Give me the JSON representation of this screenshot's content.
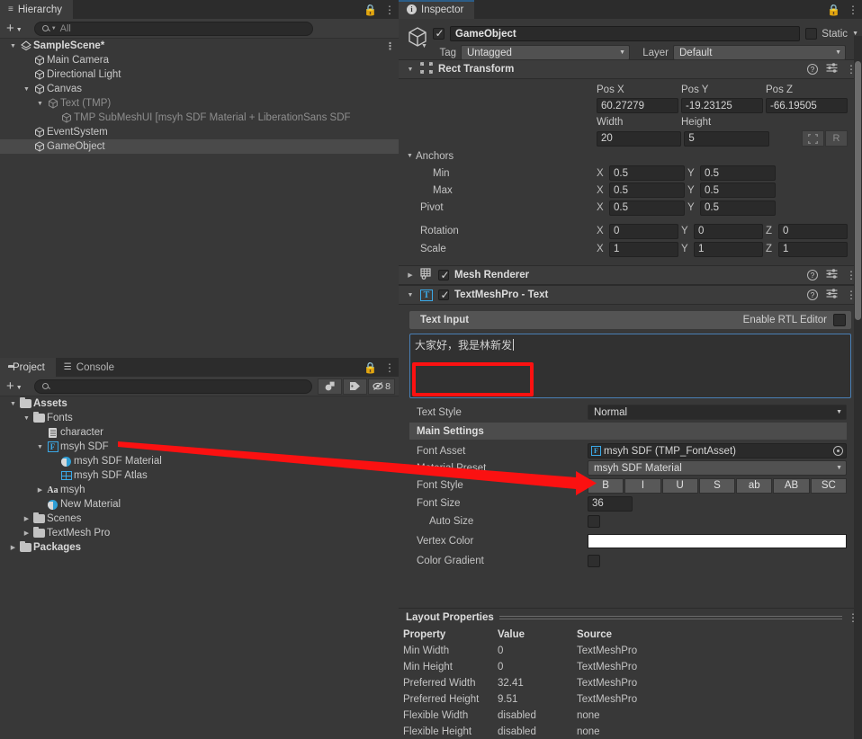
{
  "hierarchy": {
    "tab_label": "Hierarchy",
    "search_placeholder": "All",
    "items": [
      {
        "label": "SampleScene*",
        "depth": 0,
        "icon": "scene-icon",
        "arrow": "open",
        "bold": true,
        "dim": false,
        "selected": false,
        "kebab": true
      },
      {
        "label": "Main Camera",
        "depth": 1,
        "icon": "cube-icon",
        "arrow": "none",
        "bold": false,
        "dim": false,
        "selected": false,
        "kebab": false
      },
      {
        "label": "Directional Light",
        "depth": 1,
        "icon": "cube-icon",
        "arrow": "none",
        "bold": false,
        "dim": false,
        "selected": false,
        "kebab": false
      },
      {
        "label": "Canvas",
        "depth": 1,
        "icon": "cube-icon",
        "arrow": "open",
        "bold": false,
        "dim": false,
        "selected": false,
        "kebab": false
      },
      {
        "label": "Text (TMP)",
        "depth": 2,
        "icon": "cube-icon",
        "arrow": "open",
        "bold": false,
        "dim": true,
        "selected": false,
        "kebab": false
      },
      {
        "label": "TMP SubMeshUI [msyh SDF Material + LiberationSans SDF",
        "depth": 3,
        "icon": "cube-icon",
        "arrow": "none",
        "bold": false,
        "dim": true,
        "selected": false,
        "kebab": false
      },
      {
        "label": "EventSystem",
        "depth": 1,
        "icon": "cube-icon",
        "arrow": "none",
        "bold": false,
        "dim": false,
        "selected": false,
        "kebab": false
      },
      {
        "label": "GameObject",
        "depth": 1,
        "icon": "cube-icon",
        "arrow": "none",
        "bold": false,
        "dim": false,
        "selected": true,
        "kebab": false
      }
    ]
  },
  "project": {
    "tab_label": "Project",
    "console_tab_label": "Console",
    "search_placeholder": "",
    "error_count": "8",
    "items": [
      {
        "label": "Assets",
        "depth": 0,
        "icon": "folder-open-icon",
        "arrow": "open",
        "bold": true,
        "dim": false
      },
      {
        "label": "Fonts",
        "depth": 1,
        "icon": "folder-open-icon",
        "arrow": "open",
        "bold": false,
        "dim": false
      },
      {
        "label": "character",
        "depth": 2,
        "icon": "document-icon",
        "arrow": "none",
        "bold": false,
        "dim": false
      },
      {
        "label": "msyh SDF",
        "depth": 2,
        "icon": "font-asset-icon",
        "arrow": "open",
        "bold": false,
        "dim": false
      },
      {
        "label": "msyh SDF Material",
        "depth": 3,
        "icon": "material-icon",
        "arrow": "none",
        "bold": false,
        "dim": false
      },
      {
        "label": "msyh SDF Atlas",
        "depth": 3,
        "icon": "atlas-icon",
        "arrow": "none",
        "bold": false,
        "dim": false
      },
      {
        "label": "msyh",
        "depth": 2,
        "icon": "font-icon",
        "arrow": "closed",
        "bold": false,
        "dim": false
      },
      {
        "label": "New Material",
        "depth": 2,
        "icon": "material-icon",
        "arrow": "none",
        "bold": false,
        "dim": false
      },
      {
        "label": "Scenes",
        "depth": 1,
        "icon": "folder-icon",
        "arrow": "closed",
        "bold": false,
        "dim": false
      },
      {
        "label": "TextMesh Pro",
        "depth": 1,
        "icon": "folder-icon",
        "arrow": "closed",
        "bold": false,
        "dim": false
      },
      {
        "label": "Packages",
        "depth": 0,
        "icon": "folder-icon",
        "arrow": "closed",
        "bold": true,
        "dim": false
      }
    ]
  },
  "inspector": {
    "tab_label": "Inspector",
    "object_name": "GameObject",
    "enabled": true,
    "static_label": "Static",
    "tag_label": "Tag",
    "tag_value": "Untagged",
    "layer_label": "Layer",
    "layer_value": "Default",
    "rect_transform": {
      "title": "Rect Transform",
      "pos_labels": [
        "Pos X",
        "Pos Y",
        "Pos Z"
      ],
      "pos_values": [
        "60.27279",
        "-19.23125",
        "-66.19505"
      ],
      "size_labels": [
        "Width",
        "Height"
      ],
      "size_values": [
        "20",
        "5"
      ],
      "anchors_label": "Anchors",
      "min_label": "Min",
      "min_x": "0.5",
      "min_y": "0.5",
      "max_label": "Max",
      "max_x": "0.5",
      "max_y": "0.5",
      "pivot_label": "Pivot",
      "pivot_x": "0.5",
      "pivot_y": "0.5",
      "rotation_label": "Rotation",
      "rotation": [
        "0",
        "0",
        "0"
      ],
      "scale_label": "Scale",
      "scale": [
        "1",
        "1",
        "1"
      ],
      "blueprint_button": "blueprint-mode-icon",
      "raw_button": "R"
    },
    "mesh_renderer": {
      "title": "Mesh Renderer",
      "enabled": true
    },
    "textmeshpro": {
      "title": "TextMeshPro - Text",
      "enabled": true,
      "text_input_label": "Text Input",
      "rtl_label": "Enable RTL Editor",
      "rtl_checked": false,
      "text_value": "大家好，我是林新发",
      "text_style_label": "Text Style",
      "text_style_value": "Normal",
      "main_settings_label": "Main Settings",
      "font_asset_label": "Font Asset",
      "font_asset_value": "msyh SDF (TMP_FontAsset)",
      "material_preset_label": "Material Preset",
      "material_preset_value": "msyh SDF Material",
      "font_style_label": "Font Style",
      "font_style_buttons": [
        "B",
        "I",
        "U",
        "S",
        "ab",
        "AB",
        "SC"
      ],
      "font_size_label": "Font Size",
      "font_size_value": "36",
      "auto_size_label": "Auto Size",
      "auto_size_checked": false,
      "vertex_color_label": "Vertex Color",
      "vertex_color_value": "#ffffff",
      "color_gradient_label": "Color Gradient",
      "color_gradient_checked": false
    },
    "layout_properties": {
      "title": "Layout Properties",
      "columns": [
        "Property",
        "Value",
        "Source"
      ],
      "rows": [
        {
          "property": "Min Width",
          "value": "0",
          "source": "TextMeshPro"
        },
        {
          "property": "Min Height",
          "value": "0",
          "source": "TextMeshPro"
        },
        {
          "property": "Preferred Width",
          "value": "32.41",
          "source": "TextMeshPro"
        },
        {
          "property": "Preferred Height",
          "value": "9.51",
          "source": "TextMeshPro"
        },
        {
          "property": "Flexible Width",
          "value": "disabled",
          "source": "none"
        },
        {
          "property": "Flexible Height",
          "value": "disabled",
          "source": "none"
        }
      ]
    }
  },
  "annotation": {
    "arrow_color": "#fb1111",
    "highlight_color": "#fb1111"
  }
}
